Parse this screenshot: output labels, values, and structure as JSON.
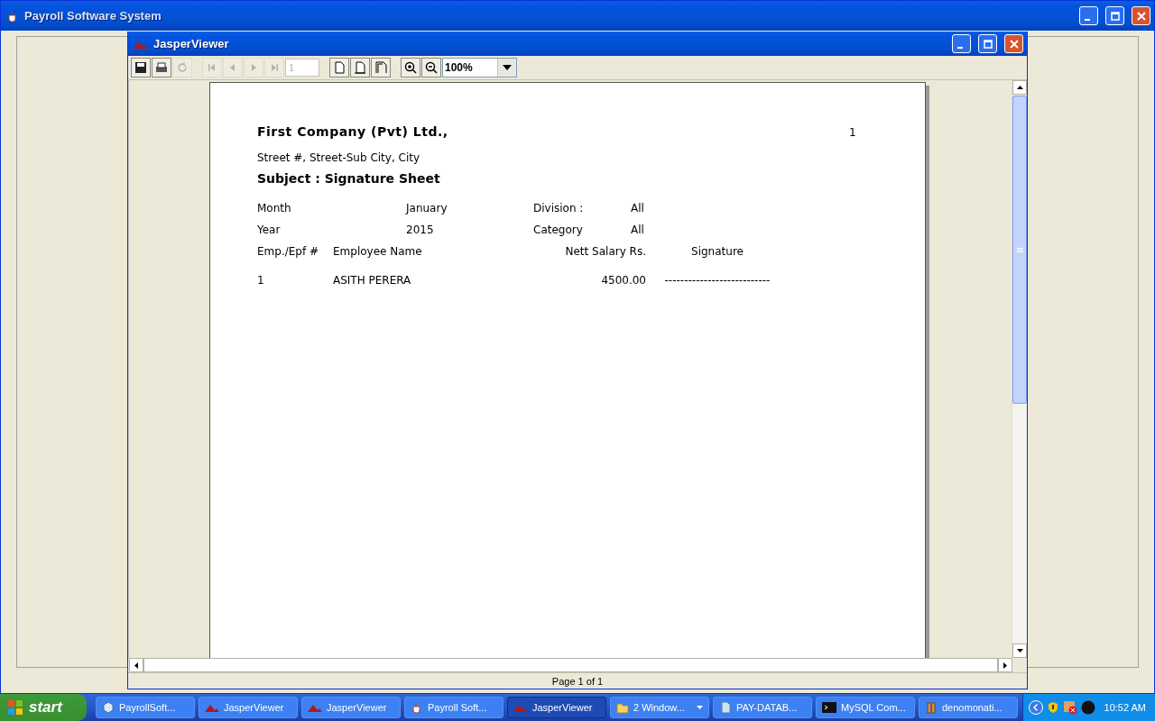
{
  "app_window": {
    "title": "Payroll Software System"
  },
  "viewer": {
    "title": "JasperViewer",
    "toolbar": [
      {
        "kind": "save",
        "disabled": false
      },
      {
        "kind": "print",
        "disabled": false
      },
      {
        "kind": "reload",
        "disabled": true
      },
      {
        "kind": "sep"
      },
      {
        "kind": "first",
        "disabled": true
      },
      {
        "kind": "prev",
        "disabled": true
      },
      {
        "kind": "next",
        "disabled": true
      },
      {
        "kind": "last",
        "disabled": true
      },
      {
        "kind": "page_field",
        "value": "1",
        "disabled": true
      },
      {
        "kind": "sep"
      },
      {
        "kind": "actual_size",
        "disabled": false
      },
      {
        "kind": "fit_page",
        "disabled": false
      },
      {
        "kind": "fit_width",
        "disabled": false
      },
      {
        "kind": "sep"
      },
      {
        "kind": "zoom_in",
        "disabled": false
      },
      {
        "kind": "zoom_out",
        "disabled": false
      },
      {
        "kind": "zoom_combo",
        "value": "100%"
      }
    ],
    "status": "Page 1 of 1"
  },
  "report": {
    "company": "First Company (Pvt) Ltd.,",
    "page_number": "1",
    "address": "Street #, Street-Sub City, City",
    "subject": "Subject : Signature Sheet",
    "params": [
      {
        "label": "Month",
        "value": "January",
        "label2": "Division :",
        "value2": "All"
      },
      {
        "label": "Year",
        "value": "2015",
        "label2": "Category",
        "value2": "All"
      }
    ],
    "columns": [
      "Emp./Epf #",
      "Employee Name",
      "Nett Salary Rs.",
      "Signature"
    ],
    "rows": [
      {
        "emp": "1",
        "name": "ASITH PERERA",
        "salary": "4500.00",
        "signature": "---------------------------"
      }
    ]
  },
  "taskbar": {
    "start": "start",
    "items": [
      {
        "label": "PayrollSoft...",
        "kind": "cube",
        "selected": false
      },
      {
        "label": "JasperViewer",
        "kind": "jasper",
        "selected": false
      },
      {
        "label": "JasperViewer",
        "kind": "jasper",
        "selected": false
      },
      {
        "label": "Payroll Soft...",
        "kind": "java",
        "selected": false
      },
      {
        "label": "JasperViewer",
        "kind": "jasper",
        "selected": true
      },
      {
        "label": "2 Window...",
        "kind": "folder",
        "selected": false,
        "group": true
      },
      {
        "label": "PAY-DATAB...",
        "kind": "doc",
        "selected": false
      },
      {
        "label": "MySQL Com...",
        "kind": "console",
        "selected": false
      },
      {
        "label": "denomonati...",
        "kind": "archive",
        "selected": false
      }
    ],
    "clock": "10:52 AM"
  }
}
